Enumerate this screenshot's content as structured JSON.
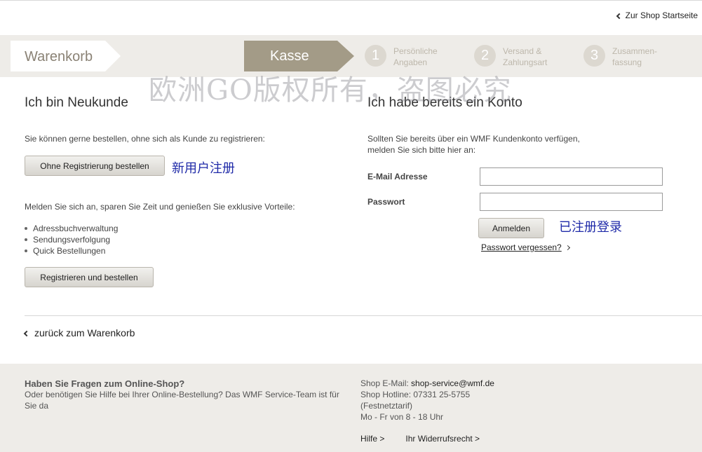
{
  "topbar": {
    "shop_link": "Zur Shop Startseite"
  },
  "steps": {
    "cart": "Warenkorb",
    "checkout": "Kasse",
    "items": [
      {
        "num": "1",
        "line1": "Persönliche",
        "line2": "Angaben"
      },
      {
        "num": "2",
        "line1": "Versand &",
        "line2": "Zahlungsart"
      },
      {
        "num": "3",
        "line1": "Zusammen-",
        "line2": "fassung"
      }
    ]
  },
  "watermark": "欧洲GO版权所有，盗图必究",
  "new_customer": {
    "heading": "Ich bin Neukunde",
    "intro": "Sie können gerne bestellen, ohne sich als Kunde zu registrieren:",
    "guest_button": "Ohne Registrierung bestellen",
    "annotation": "新用户注册",
    "benefits_intro": "Melden Sie sich an, sparen Sie Zeit und genießen Sie exklusive Vorteile:",
    "benefits": [
      "Adressbuchverwaltung",
      "Sendungsverfolgung",
      "Quick Bestellungen"
    ],
    "register_button": "Registrieren und bestellen"
  },
  "existing_customer": {
    "heading": "Ich habe bereits ein Konto",
    "intro_line1": "Sollten Sie bereits über ein WMF Kundenkonto verfügen,",
    "intro_line2": "melden Sie sich bitte hier an:",
    "email_label": "E-Mail Adresse",
    "email_value": "",
    "password_label": "Passwort",
    "password_value": "",
    "login_button": "Anmelden",
    "annotation": "已注册登录",
    "forgot_link": "Passwort vergessen?"
  },
  "back_link": "zurück zum Warenkorb",
  "footer": {
    "title": "Haben Sie Fragen zum Online-Shop?",
    "text": "Oder benötigen Sie Hilfe bei Ihrer Online-Bestellung?  Das WMF Service-Team ist für Sie da",
    "email_label": "Shop E-Mail:",
    "email": "shop-service@wmf.de",
    "hotline": "Shop Hotline: 07331 25-5755",
    "tariff": "(Festnetztarif)",
    "hours": "Mo - Fr von 8 - 18 Uhr",
    "help_link": "Hilfe >",
    "withdrawal_link": "Ihr Widerrufsrecht >"
  }
}
